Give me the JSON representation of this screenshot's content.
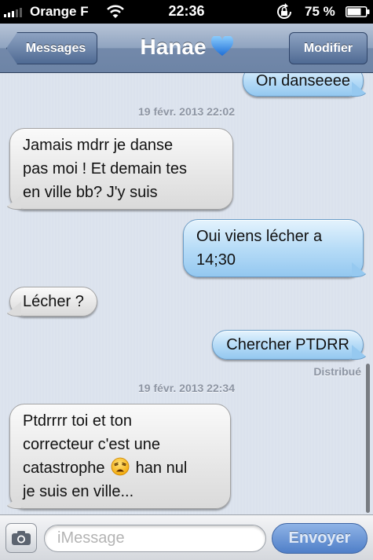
{
  "status_bar": {
    "carrier": "Orange F",
    "time": "22:36",
    "battery_percent": "75 %",
    "icons": [
      "signal-icon",
      "wifi-icon",
      "rotation-lock-icon",
      "battery-icon"
    ]
  },
  "nav": {
    "back_label": "Messages",
    "title": "Hanae",
    "title_icon": "blue-heart-icon",
    "edit_label": "Modifier"
  },
  "conversation": {
    "top_partial_message": "On danseeee",
    "timestamp_1": "19 févr. 2013 22:02",
    "msg_1": [
      "Jamais mdrr je danse",
      "pas moi ! Et demain tes",
      "en ville bb? J'y suis"
    ],
    "msg_2": [
      "Oui viens lécher a",
      "14;30"
    ],
    "msg_3": "Lécher ?",
    "msg_4": "Chercher PTDRR",
    "delivered_label": "Distribué",
    "timestamp_2": "19 févr. 2013 22:34",
    "msg_5": {
      "line_1": "Ptdrrrr toi et ton",
      "line_2": "correcteur c'est une",
      "line_3_before_emoji": "catastrophe",
      "emoji": "weary-face-emoji",
      "line_3_after_emoji": "han nul",
      "line_4": "je suis en ville..."
    }
  },
  "input_bar": {
    "camera_icon": "camera-icon",
    "placeholder": "iMessage",
    "send_label": "Envoyer"
  },
  "colors": {
    "nav_bar": "#7389aa",
    "sent_bubble": "#b7dcf7",
    "received_bubble": "#e6e6e6",
    "conversation_bg": "#dbe2ed",
    "send_button": "#4f7fc8"
  }
}
